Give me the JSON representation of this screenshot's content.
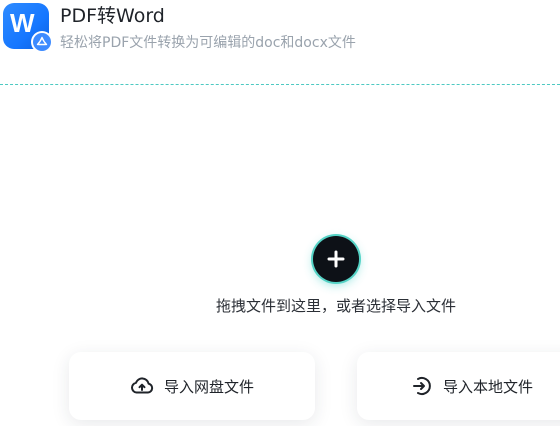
{
  "header": {
    "title": "PDF转Word",
    "subtitle": "轻松将PDF文件转换为可编辑的doc和docx文件",
    "app_icon_letter": "W"
  },
  "upload": {
    "drop_hint": "拖拽文件到这里，或者选择导入文件",
    "accent_color": "#4ec9c2"
  },
  "actions": {
    "import_cloud_label": "导入网盘文件",
    "import_local_label": "导入本地文件"
  },
  "icons": {
    "app": "word-app-icon",
    "badge": "pdf-badge-icon",
    "add": "plus-icon",
    "cloud": "cloud-upload-icon",
    "local": "import-arrow-icon"
  }
}
